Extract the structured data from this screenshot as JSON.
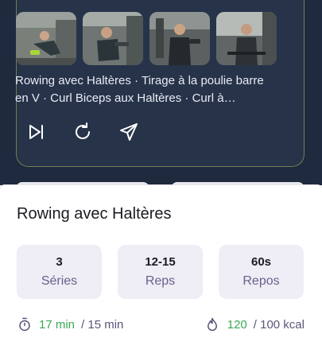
{
  "exercise_list_text": "Rowing avec Haltères · Tirage à la poulie barre en V · Curl Biceps aux Haltères · Curl à…",
  "thumbnails": [
    {
      "name": "rowing-thumbnail"
    },
    {
      "name": "tirage-poulie-thumbnail"
    },
    {
      "name": "curl-biceps-thumbnail"
    },
    {
      "name": "curl-barre-thumbnail"
    }
  ],
  "actions": {
    "skip_icon": "skip-next-icon",
    "repeat_icon": "refresh-icon",
    "send_icon": "send-icon"
  },
  "exercise": {
    "title": "Rowing avec Haltères",
    "stats": [
      {
        "value": "3",
        "label": "Séries"
      },
      {
        "value": "12-15",
        "label": "Reps"
      },
      {
        "value": "60s",
        "label": "Repos"
      }
    ],
    "duration_current": "17 min",
    "duration_target": "/ 15 min",
    "calories_current": "120",
    "calories_target": "/ 100 kcal"
  },
  "colors": {
    "dark_bg": "#1f2a3e",
    "card_bg": "#273349",
    "accent_green": "#3aa854",
    "stat_bg": "#efedf5",
    "muted_purple": "#5b5479"
  }
}
